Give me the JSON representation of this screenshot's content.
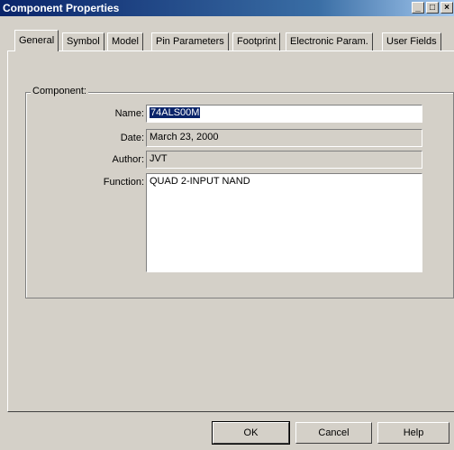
{
  "window": {
    "title": "Component Properties"
  },
  "titlebar_buttons": {
    "minimize": "_",
    "maximize": "□",
    "close": "×"
  },
  "tabs": [
    {
      "label": "General",
      "active": true
    },
    {
      "label": "Symbol"
    },
    {
      "label": "Model"
    },
    {
      "label": "Pin Parameters"
    },
    {
      "label": "Footprint"
    },
    {
      "label": "Electronic Param."
    },
    {
      "label": "User Fields"
    }
  ],
  "component": {
    "group_label": "Component:",
    "name_label": "Name:",
    "name_value": "74ALS00M",
    "date_label": "Date:",
    "date_value": "March 23, 2000",
    "author_label": "Author:",
    "author_value": "JVT",
    "function_label": "Function:",
    "function_value": "QUAD 2-INPUT NAND"
  },
  "buttons": {
    "ok": "OK",
    "cancel": "Cancel",
    "help": "Help"
  }
}
